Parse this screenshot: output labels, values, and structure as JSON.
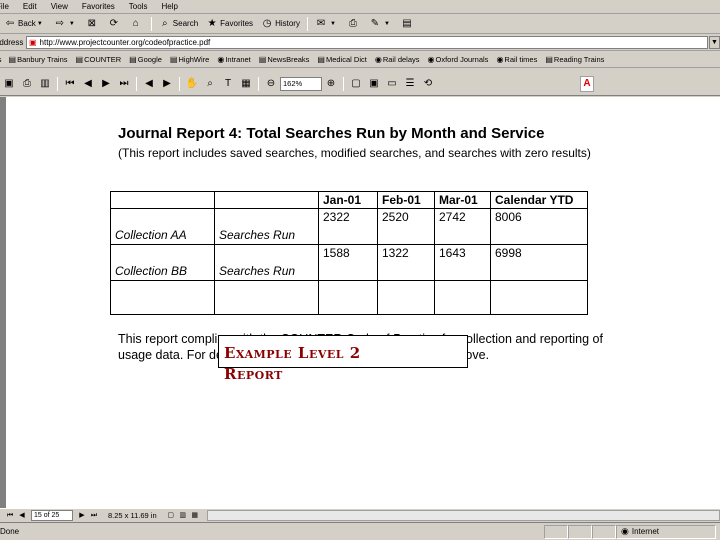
{
  "menu": [
    "File",
    "Edit",
    "View",
    "Favorites",
    "Tools",
    "Help"
  ],
  "toolbar": {
    "back": "Back",
    "search": "Search",
    "favorites": "Favorites",
    "history": "History"
  },
  "address": {
    "label": "Address",
    "url": "http://www.projectcounter.org/codeofpractice.pdf"
  },
  "links": [
    "Banbury Trains",
    "COUNTER",
    "Google",
    "HighWire",
    "Intranet",
    "NewsBreaks",
    "Medical Dict",
    "Rail delays",
    "Oxford Journals",
    "Rail times",
    "Reading Trains"
  ],
  "pdf_toolbar": {
    "zoom": "162%"
  },
  "report": {
    "title": "Journal Report 4: Total Searches Run by Month and Service",
    "subtitle": "(This report includes saved searches, modified searches, and searches with zero results)",
    "columns": [
      "",
      "",
      "Jan-01",
      "Feb-01",
      "Mar-01",
      "Calendar YTD"
    ],
    "rows": [
      {
        "collection": "Collection AA",
        "metric": "Searches Run",
        "jan": "2322",
        "feb": "2520",
        "mar": "2742",
        "ytd": "8006"
      },
      {
        "collection": "Collection BB",
        "metric": "Searches Run",
        "jan": "1588",
        "feb": "1322",
        "mar": "1643",
        "ytd": "6998"
      }
    ],
    "compliance": "This report complies with the COUNTER Code of Practice for collection and reporting of usage data. For definitions of the terms used, see Section 3 above."
  },
  "overlay_label": "Example Level 2 Report",
  "pdf_status": {
    "page": "15 of 25",
    "size": "8.25 x 11.69 in"
  },
  "ie_status": {
    "text": "Done",
    "zone": "Internet"
  },
  "colors": {
    "chrome": "#d4d0c8",
    "overlay_text": "#8b0000"
  }
}
